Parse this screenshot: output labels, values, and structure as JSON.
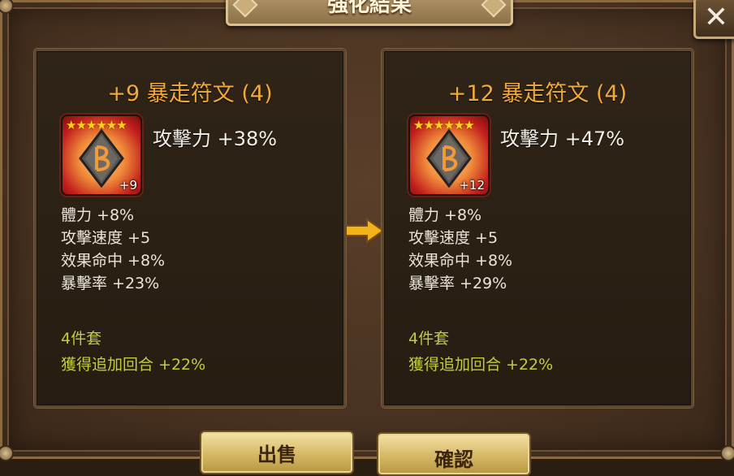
{
  "dialog": {
    "title": "強化結果",
    "close_label": "✕"
  },
  "before": {
    "rune_title": "+9 暴走符文 (4)",
    "stars": "★★★★★★",
    "level_badge": "+9",
    "main_stat": "攻擊力 +38%",
    "sub_stats": [
      "體力 +8%",
      "攻擊速度 +5",
      "效果命中 +8%",
      "暴擊率 +23%"
    ],
    "set_name": "4件套",
    "set_effect": "獲得追加回合 +22%"
  },
  "after": {
    "rune_title": "+12 暴走符文 (4)",
    "stars": "★★★★★★",
    "level_badge": "+12",
    "main_stat": "攻擊力 +47%",
    "sub_stats": [
      "體力 +8%",
      "攻擊速度 +5",
      "效果命中 +8%",
      "暴擊率 +29%"
    ],
    "set_name": "4件套",
    "set_effect": "獲得追加回合 +22%"
  },
  "buttons": {
    "sell_label": "出售",
    "confirm_label": "確認"
  },
  "colors": {
    "rune_title": "#f1aa38",
    "set_text": "#bfcf3a",
    "arrow": "#f1b21a"
  },
  "icons": {
    "rune": "rune-icon",
    "arrow": "arrow-right-icon",
    "close": "close-icon"
  }
}
